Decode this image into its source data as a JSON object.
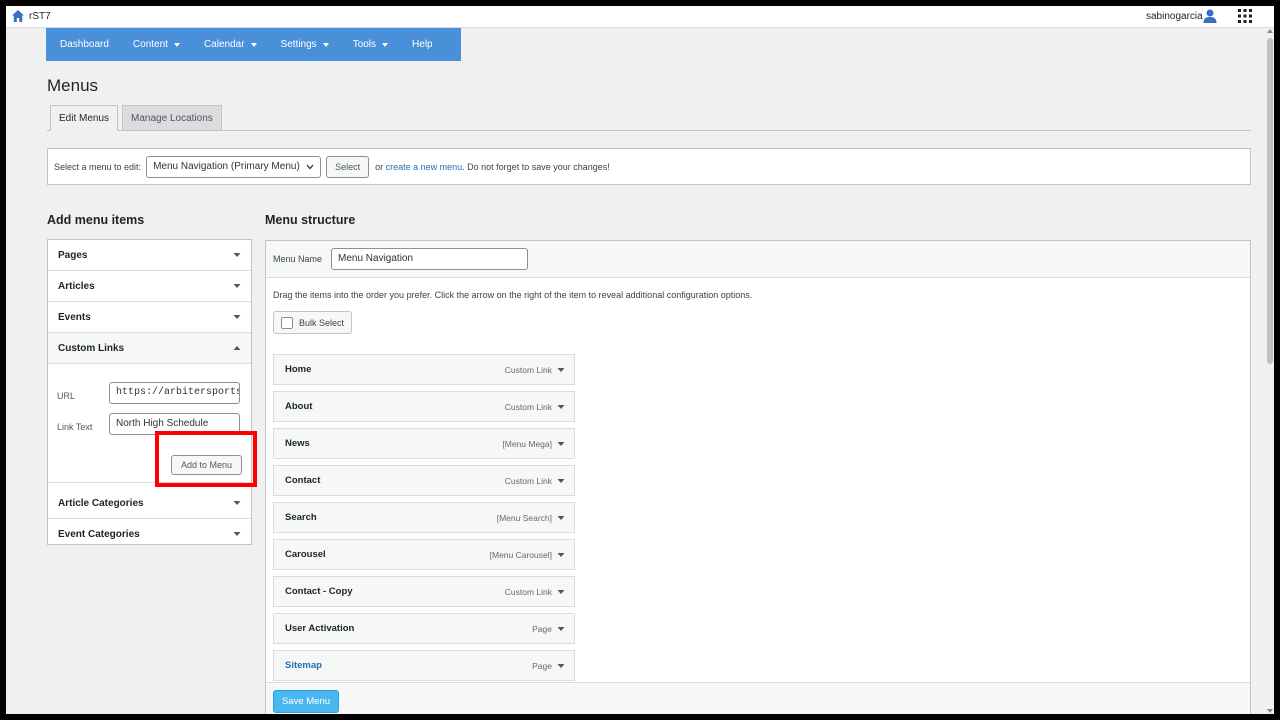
{
  "topbar": {
    "site_name": "rST7",
    "username": "sabinogarcia",
    "icons": {
      "home": "home-icon",
      "user": "user-icon",
      "apps": "apps-grid-icon"
    }
  },
  "nav": {
    "items": [
      {
        "label": "Dashboard",
        "dropdown": false
      },
      {
        "label": "Content",
        "dropdown": true
      },
      {
        "label": "Calendar",
        "dropdown": true
      },
      {
        "label": "Settings",
        "dropdown": true
      },
      {
        "label": "Tools",
        "dropdown": true
      },
      {
        "label": "Help",
        "dropdown": false
      }
    ],
    "color": "#4a90d9"
  },
  "page": {
    "title": "Menus",
    "tabs": [
      {
        "label": "Edit Menus",
        "active": true
      },
      {
        "label": "Manage Locations",
        "active": false
      }
    ]
  },
  "select_menu": {
    "prompt": "Select a menu to edit:",
    "selected": "Menu Navigation (Primary Menu)",
    "select_button": "Select",
    "or_text": "or",
    "create_link": "create a new menu",
    "suffix": ". Do not forget to save your changes!"
  },
  "add_items": {
    "title": "Add menu items",
    "panels": [
      {
        "label": "Pages",
        "expanded": false
      },
      {
        "label": "Articles",
        "expanded": false
      },
      {
        "label": "Events",
        "expanded": false
      },
      {
        "label": "Custom Links",
        "expanded": true
      },
      {
        "label": "Article Categories",
        "expanded": false
      },
      {
        "label": "Event Categories",
        "expanded": false
      }
    ],
    "custom_links": {
      "url_label": "URL",
      "url_value": "https://arbitersports",
      "link_text_label": "Link Text",
      "link_text_value": "North High Schedule",
      "add_button": "Add to Menu"
    }
  },
  "structure": {
    "title": "Menu structure",
    "menu_name_label": "Menu Name",
    "menu_name_value": "Menu Navigation",
    "instructions": "Drag the items into the order you prefer. Click the arrow on the right of the item to reveal additional configuration options.",
    "bulk_select": "Bulk Select",
    "items": [
      {
        "title": "Home",
        "type": "Custom Link"
      },
      {
        "title": "About",
        "type": "Custom Link"
      },
      {
        "title": "News",
        "type": "[Menu Mega]"
      },
      {
        "title": "Contact",
        "type": "Custom Link"
      },
      {
        "title": "Search",
        "type": "[Menu Search]"
      },
      {
        "title": "Carousel",
        "type": "[Menu Carousel]"
      },
      {
        "title": "Contact - Copy",
        "type": "Custom Link"
      },
      {
        "title": "User Activation",
        "type": "Page"
      },
      {
        "title": "Sitemap",
        "type": "Page"
      }
    ],
    "save_button": "Save Menu",
    "save_color": "#4ab8f0"
  },
  "annotation": {
    "highlight_color": "#ff0000",
    "target": "add-to-menu-button"
  }
}
